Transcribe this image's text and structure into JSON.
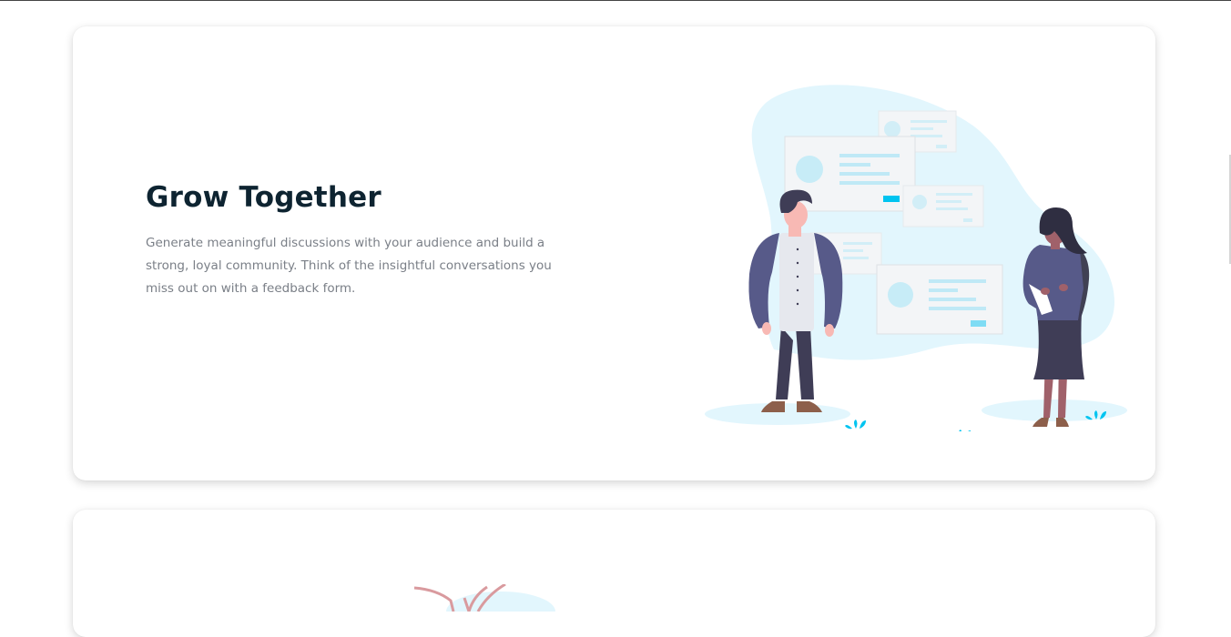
{
  "feature": {
    "title": "Grow Together",
    "description": "Generate meaningful discussions with your audience and build a strong, loyal community. Think of the insightful conversations you miss out on with a feedback form."
  },
  "illustration": {
    "icon": "people-discussion-illustration",
    "colors": {
      "blob": "#e2f6fd",
      "accent": "#00c4f0",
      "panel": "#f3f5f7",
      "panel_line": "#bfe9f6",
      "jacket": "#575a89",
      "dark": "#3f3d56",
      "skin": "#f8b9b4",
      "hair": "#2f2e41"
    }
  }
}
